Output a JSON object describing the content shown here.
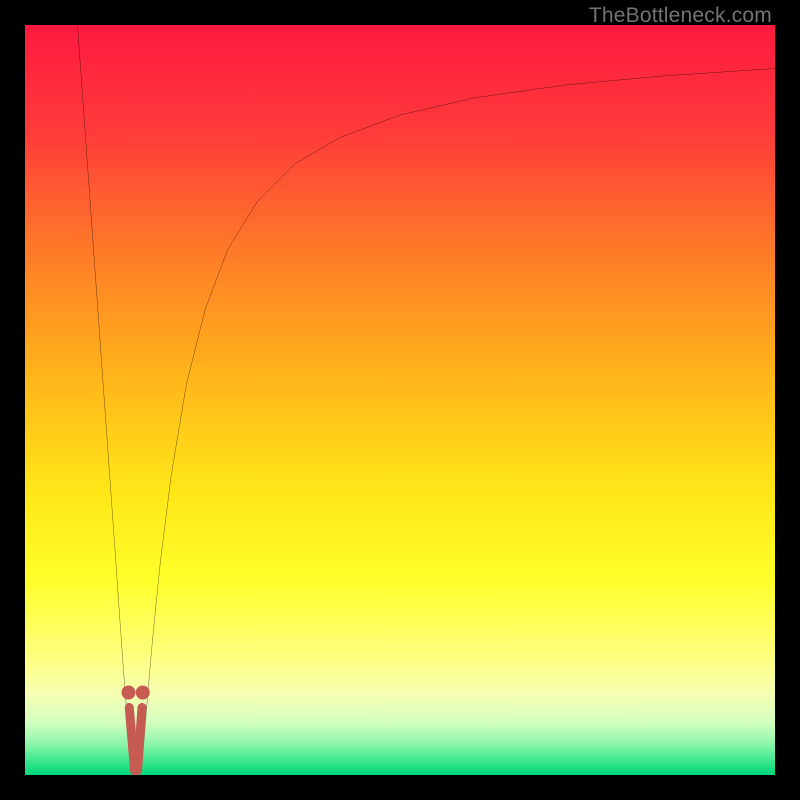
{
  "watermark": "TheBottleneck.com",
  "chart_data": {
    "type": "line",
    "title": "",
    "xlabel": "",
    "ylabel": "",
    "xlim": [
      0,
      100
    ],
    "ylim": [
      0,
      100
    ],
    "grid": false,
    "legend": false,
    "background_gradient_stops": [
      {
        "offset": 0.0,
        "color": "#ff1a3f"
      },
      {
        "offset": 0.14,
        "color": "#ff3a3a"
      },
      {
        "offset": 0.3,
        "color": "#ff7a28"
      },
      {
        "offset": 0.46,
        "color": "#ffb21a"
      },
      {
        "offset": 0.62,
        "color": "#ffe617"
      },
      {
        "offset": 0.74,
        "color": "#ffff2a"
      },
      {
        "offset": 0.84,
        "color": "#ffff7d"
      },
      {
        "offset": 0.89,
        "color": "#f6ffb0"
      },
      {
        "offset": 0.93,
        "color": "#d4ffc0"
      },
      {
        "offset": 0.96,
        "color": "#88f5a8"
      },
      {
        "offset": 0.985,
        "color": "#2fe38a"
      },
      {
        "offset": 1.0,
        "color": "#00d77a"
      }
    ],
    "series": [
      {
        "name": "left-branch",
        "type": "line",
        "color": "#000000",
        "stroke_width": 2.2,
        "x": [
          7.0,
          8.0,
          9.0,
          10.0,
          11.0,
          12.0,
          12.7,
          13.2,
          13.6,
          13.9,
          14.1
        ],
        "y": [
          100.0,
          86.0,
          72.0,
          58.0,
          44.0,
          30.0,
          20.0,
          13.0,
          8.0,
          4.0,
          1.5
        ]
      },
      {
        "name": "right-branch",
        "type": "line",
        "color": "#000000",
        "stroke_width": 2.2,
        "x": [
          15.6,
          15.9,
          16.3,
          17.0,
          18.0,
          19.5,
          21.5,
          24.0,
          27.0,
          31.0,
          36.0,
          42.0,
          50.0,
          60.0,
          72.0,
          85.0,
          100.0
        ],
        "y": [
          1.5,
          5.0,
          10.0,
          18.0,
          28.0,
          40.0,
          52.0,
          62.0,
          70.0,
          76.5,
          81.5,
          85.0,
          88.0,
          90.3,
          92.0,
          93.2,
          94.2
        ]
      },
      {
        "name": "valley-dots",
        "type": "scatter",
        "color": "#c65b52",
        "radius": 7,
        "x": [
          13.8,
          15.7
        ],
        "y": [
          11.0,
          11.0
        ]
      },
      {
        "name": "valley-ticks",
        "type": "line",
        "color": "#c65b52",
        "stroke_width": 9,
        "stroke_linecap": "round",
        "segments": [
          {
            "x1": 13.9,
            "y1": 9.0,
            "x2": 14.6,
            "y2": 0.6
          },
          {
            "x1": 15.6,
            "y1": 9.0,
            "x2": 15.0,
            "y2": 0.6
          }
        ]
      }
    ]
  }
}
